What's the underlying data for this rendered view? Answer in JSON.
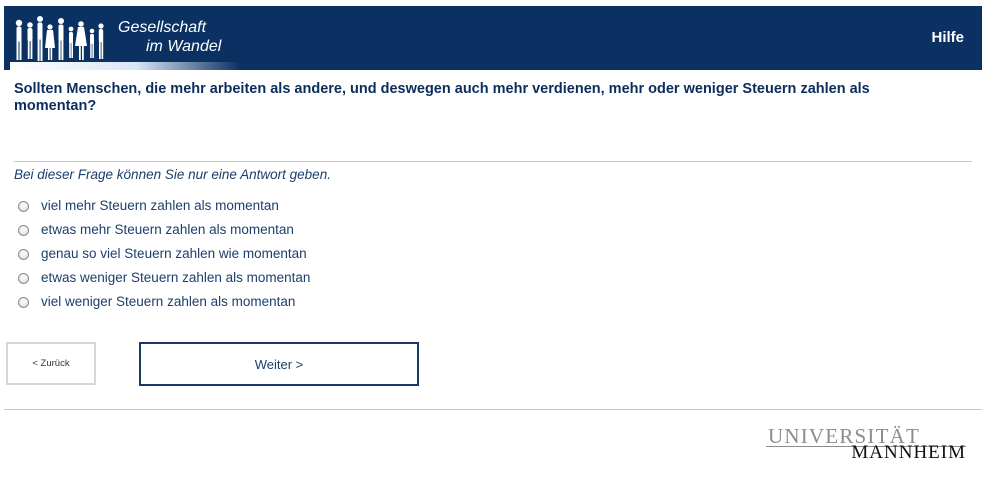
{
  "header": {
    "logo_line1": "Gesellschaft",
    "logo_line2": "im Wandel",
    "help_label": "Hilfe",
    "background_color": "#0b3163"
  },
  "survey": {
    "question": "Sollten Menschen, die mehr arbeiten als andere, und deswegen auch mehr verdienen, mehr oder weniger Steuern zahlen als momentan?",
    "instruction": "Bei dieser Frage können Sie nur eine Antwort geben.",
    "options": [
      "viel mehr Steuern zahlen als momentan",
      "etwas mehr Steuern zahlen als momentan",
      "genau so viel Steuern zahlen wie momentan",
      "etwas weniger Steuern zahlen als momentan",
      "viel weniger Steuern zahlen als momentan"
    ]
  },
  "nav": {
    "back_label": "< Zurück",
    "next_label": "Weiter >"
  },
  "footer": {
    "university_line1": "UNIVERSITÄT",
    "university_line2": "MANNHEIM"
  }
}
